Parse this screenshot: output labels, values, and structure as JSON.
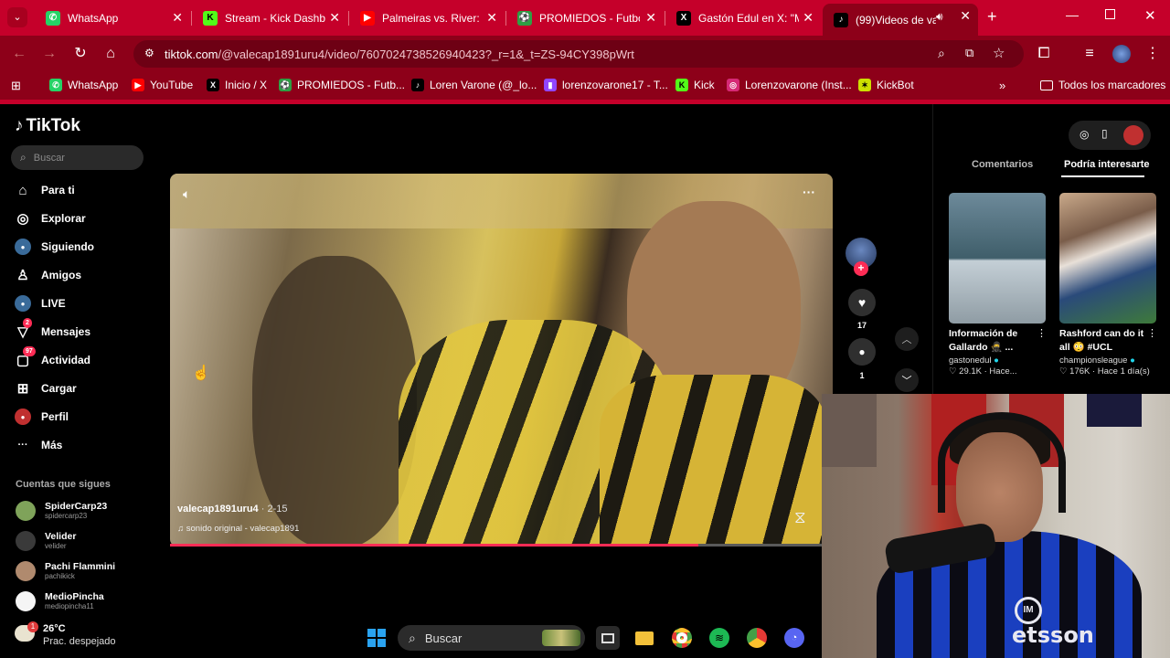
{
  "browser": {
    "tabs": [
      {
        "label": "WhatsApp",
        "icon": "whatsapp-icon",
        "color": "#25d366",
        "glyph": "✆"
      },
      {
        "label": "Stream - Kick Dashbo",
        "icon": "kick-icon",
        "color": "#53fc18",
        "glyph": "K"
      },
      {
        "label": "Palmeiras vs. River: go",
        "icon": "youtube-icon",
        "color": "#ff0000",
        "glyph": "▶"
      },
      {
        "label": "PROMIEDOS - Futbol",
        "icon": "promiedos-icon",
        "color": "#2e9e44",
        "glyph": "⚽"
      },
      {
        "label": "Gastón Edul en X: \"M",
        "icon": "x-icon",
        "color": "#000000",
        "glyph": "X"
      },
      {
        "label": "(99)Videos de val",
        "icon": "tiktok-icon",
        "color": "#000000",
        "glyph": "♪"
      }
    ],
    "url_host": "tiktok.com",
    "url_rest": "/@valecap1891uru4/video/7607024738526940423?_r=1&_t=ZS-94CY398pWrt",
    "bookmarks": [
      {
        "label": "WhatsApp",
        "icon": "whatsapp-icon",
        "color": "#25d366",
        "glyph": "✆"
      },
      {
        "label": "YouTube",
        "icon": "youtube-icon",
        "color": "#ff0000",
        "glyph": "▶"
      },
      {
        "label": "Inicio / X",
        "icon": "x-icon",
        "color": "#000000",
        "glyph": "X"
      },
      {
        "label": "PROMIEDOS - Futb...",
        "icon": "promiedos-icon",
        "color": "#2e9e44",
        "glyph": "⚽"
      },
      {
        "label": "Loren Varone (@_lo...",
        "icon": "tiktok-icon",
        "color": "#000000",
        "glyph": "♪"
      },
      {
        "label": "lorenzovarone17 - T...",
        "icon": "twitch-icon",
        "color": "#9146ff",
        "glyph": "▮"
      },
      {
        "label": "Kick",
        "icon": "kick-icon",
        "color": "#53fc18",
        "glyph": "K"
      },
      {
        "label": "Lorenzovarone (Inst...",
        "icon": "instagram-icon",
        "color": "#d62976",
        "glyph": "◎"
      },
      {
        "label": "KickBot",
        "icon": "kickbot-icon",
        "color": "#cde000",
        "glyph": "✶"
      }
    ],
    "all_bookmarks": "Todos los marcadores"
  },
  "tiktok": {
    "logo": "TikTok",
    "search_placeholder": "Buscar",
    "nav": [
      {
        "label": "Para ti",
        "icon": "home-icon",
        "glyph": "⌂"
      },
      {
        "label": "Explorar",
        "icon": "compass-icon",
        "glyph": "◎"
      },
      {
        "label": "Siguiendo",
        "icon": "following-icon",
        "glyph": "●"
      },
      {
        "label": "Amigos",
        "icon": "friends-icon",
        "glyph": "♙"
      },
      {
        "label": "LIVE",
        "icon": "live-icon",
        "glyph": "●"
      },
      {
        "label": "Mensajes",
        "icon": "messages-icon",
        "glyph": "▽",
        "badge": "2"
      },
      {
        "label": "Actividad",
        "icon": "activity-icon",
        "glyph": "▢",
        "badge": "97"
      },
      {
        "label": "Cargar",
        "icon": "upload-icon",
        "glyph": "⊞"
      },
      {
        "label": "Perfil",
        "icon": "profile-icon",
        "glyph": "●"
      },
      {
        "label": "Más",
        "icon": "more-icon",
        "glyph": "···"
      }
    ],
    "following_title": "Cuentas que sigues",
    "following": [
      {
        "name": "SpiderCarp23",
        "handle": "spidercarp23",
        "color": "#7fa35a"
      },
      {
        "name": "Velider",
        "handle": "velider",
        "color": "#3a3a3a"
      },
      {
        "name": "Pachi Flammini",
        "handle": "pachikick",
        "color": "#b08a6e"
      },
      {
        "name": "MedioPincha",
        "handle": "mediopincha11",
        "color": "#f5f5f5"
      }
    ],
    "video": {
      "username": "valecap1891uru4",
      "date": "· 2-15",
      "sound": "♫ sonido original - valecap1891",
      "progress": 0.81
    },
    "actions": {
      "likes": "17",
      "comments": "1"
    },
    "right_tabs": [
      "Comentarios",
      "Podría interesarte"
    ],
    "cards": [
      {
        "title": "Información de Gallardo 🥷 ...",
        "author": "gastonedul",
        "views": "♡ 29.1K · Hace...",
        "verified": true
      },
      {
        "title": "Rashford can do it all 😳 #UCL",
        "author": "championsleague",
        "views": "♡ 176K · Hace 1 día(s)",
        "verified": true
      }
    ]
  },
  "taskbar": {
    "temp": "26°C",
    "weather": "Prac. despejado",
    "weather_badge": "1",
    "search": "Buscar"
  },
  "webcam": {
    "shirt_brand": "etsson",
    "crest": "IM"
  }
}
